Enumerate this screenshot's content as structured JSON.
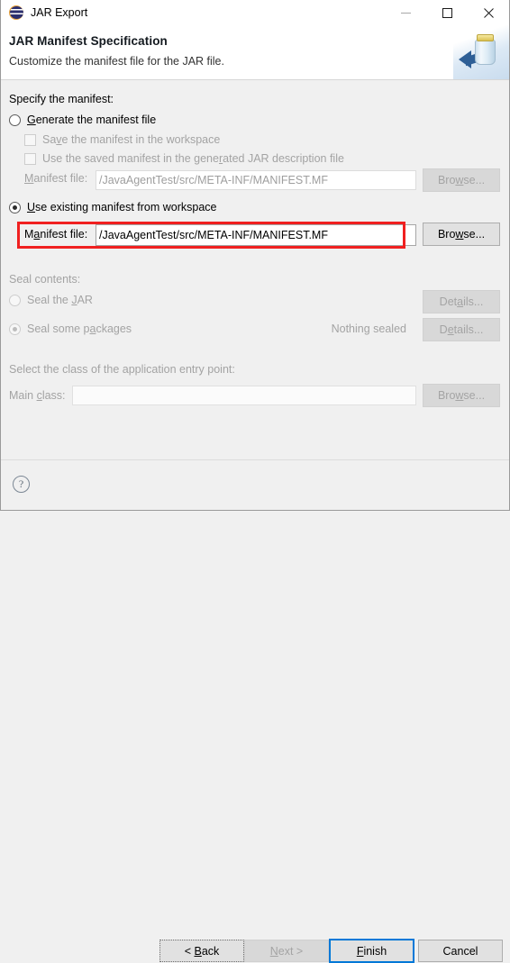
{
  "window": {
    "title": "JAR Export",
    "icon": "jar-export-icon",
    "controls": {
      "minimize": "minimize-icon",
      "maximize": "maximize-icon",
      "close": "close-icon"
    }
  },
  "header": {
    "title": "JAR Manifest Specification",
    "subtitle": "Customize the manifest file for the JAR file.",
    "art": "jar-export-banner-icon"
  },
  "manifest_section": {
    "group_label": "Specify the manifest:",
    "generate": {
      "label_pre": "",
      "label_mnemonic": "G",
      "label_post": "enerate the manifest file",
      "selected": false
    },
    "save_in_workspace": {
      "label_pre": "Sa",
      "label_mnemonic": "v",
      "label_post": "e the manifest in the workspace",
      "checked": false,
      "enabled": false
    },
    "use_saved_manifest": {
      "label_pre": "Use the saved manifest in the gene",
      "label_mnemonic": "r",
      "label_post": "ated JAR description file",
      "checked": false,
      "enabled": false
    },
    "generate_manifest_file": {
      "label_pre": "",
      "label_mnemonic": "M",
      "label_post": "anifest file:",
      "value": "/JavaAgentTest/src/META-INF/MANIFEST.MF",
      "enabled": false,
      "browse_pre": "Bro",
      "browse_mnemonic": "w",
      "browse_post": "se..."
    },
    "use_existing": {
      "label_pre": "",
      "label_mnemonic": "U",
      "label_post": "se existing manifest from workspace",
      "selected": true
    },
    "existing_manifest_file": {
      "label_pre": "M",
      "label_mnemonic": "a",
      "label_post": "nifest file:",
      "value": "/JavaAgentTest/src/META-INF/MANIFEST.MF",
      "enabled": true,
      "browse_pre": "Bro",
      "browse_mnemonic": "w",
      "browse_post": "se..."
    }
  },
  "seal_section": {
    "group_label": "Seal contents:",
    "seal_jar": {
      "label_pre": "Seal the ",
      "label_mnemonic": "J",
      "label_post": "AR",
      "selected": false,
      "details_pre": "Det",
      "details_mnemonic": "a",
      "details_post": "ils..."
    },
    "seal_packages": {
      "label_pre": "Seal some p",
      "label_mnemonic": "a",
      "label_post": "ckages",
      "selected": true,
      "status": "Nothing sealed",
      "details_pre": "D",
      "details_mnemonic": "e",
      "details_post": "tails..."
    }
  },
  "main_class_section": {
    "group_label": "Select the class of the application entry point:",
    "main_class": {
      "label_pre": "Main ",
      "label_mnemonic": "c",
      "label_post": "lass:",
      "value": "",
      "browse_pre": "Bro",
      "browse_mnemonic": "w",
      "browse_post": "se..."
    }
  },
  "footer": {
    "help": "?",
    "back": {
      "pre": "< ",
      "mnemonic": "B",
      "post": "ack"
    },
    "next": {
      "pre": "",
      "mnemonic": "N",
      "post": "ext >"
    },
    "finish": {
      "pre": "",
      "mnemonic": "F",
      "post": "inish"
    },
    "cancel": {
      "pre": "Cancel",
      "mnemonic": "",
      "post": ""
    }
  },
  "annotation": {
    "highlight_color": "#f02020",
    "target": "existing-manifest-file-row"
  }
}
